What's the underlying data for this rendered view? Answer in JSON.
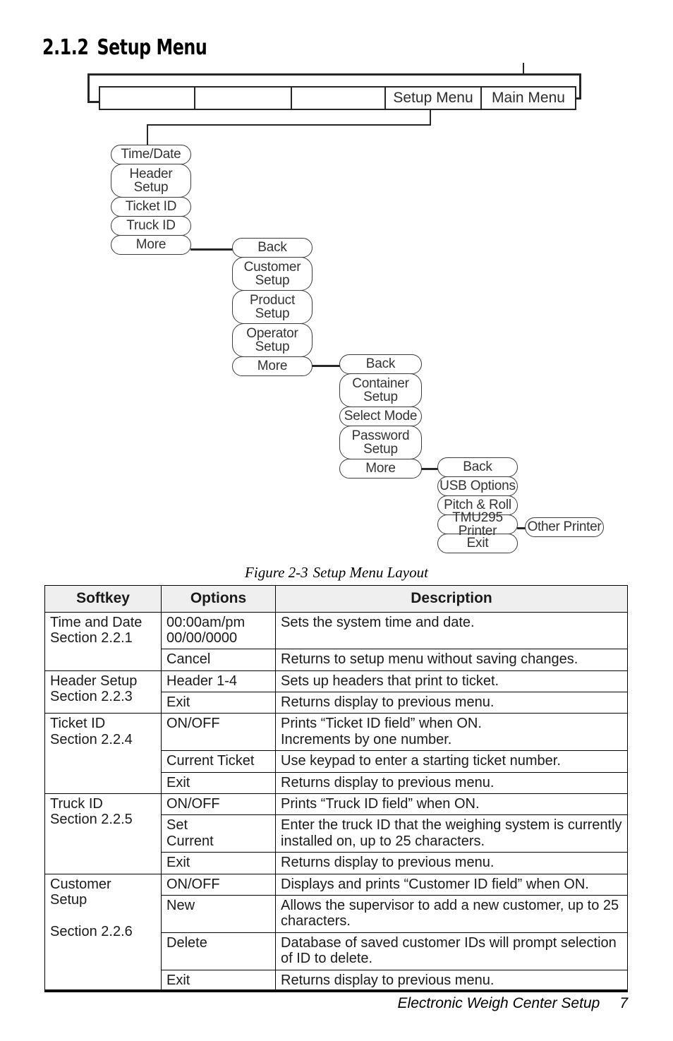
{
  "heading": {
    "number": "2.1.2",
    "title": "Setup Menu"
  },
  "diagram": {
    "menu_bar": [
      {
        "label": ""
      },
      {
        "label": ""
      },
      {
        "label": ""
      },
      {
        "label": "Setup Menu"
      },
      {
        "label": "Main Menu"
      }
    ],
    "columns": [
      {
        "name": "setup-level-1",
        "buttons": [
          "Time/Date",
          "Header\nSetup",
          "Ticket ID",
          "Truck ID",
          "More"
        ]
      },
      {
        "name": "setup-level-2",
        "buttons": [
          "Back",
          "Customer\nSetup",
          "Product\nSetup",
          "Operator\nSetup",
          "More"
        ]
      },
      {
        "name": "setup-level-3",
        "buttons": [
          "Back",
          "Container\nSetup",
          "Select Mode",
          "Password\nSetup",
          "More"
        ]
      },
      {
        "name": "setup-level-4",
        "buttons": [
          "Back",
          "USB Options",
          "Pitch & Roll",
          "TMU295 Printer",
          "Exit"
        ]
      }
    ],
    "branch_button": "Other Printer"
  },
  "caption": {
    "figure": "Figure 2-3",
    "title": "Setup Menu Layout"
  },
  "table": {
    "headers": [
      "Softkey",
      "Options",
      "Description"
    ],
    "rows": [
      {
        "softkey": "Time and Date\nSection 2.2.1",
        "softkey_rowspan": 2,
        "options": "00:00am/pm\n00/00/0000",
        "description": "Sets the system time and date."
      },
      {
        "options": "Cancel",
        "description": "Returns to setup menu without saving changes."
      },
      {
        "softkey": "Header Setup\nSection 2.2.3",
        "softkey_rowspan": 2,
        "options": "Header 1-4",
        "description": "Sets up headers that print to ticket."
      },
      {
        "options": "Exit",
        "description": "Returns display to previous menu."
      },
      {
        "softkey": "Ticket ID\nSection 2.2.4",
        "softkey_rowspan": 3,
        "options": "ON/OFF",
        "description": "Prints “Ticket ID field” when ON.\nIncrements by one number."
      },
      {
        "options": "Current Ticket",
        "description": "Use keypad to enter a starting ticket number."
      },
      {
        "options": "Exit",
        "description": "Returns display to previous menu."
      },
      {
        "softkey": "Truck ID\nSection 2.2.5",
        "softkey_rowspan": 3,
        "options": "ON/OFF",
        "description": "Prints “Truck ID field” when ON."
      },
      {
        "options": "Set\nCurrent",
        "description": "Enter the truck ID that the weighing system is currently installed on, up to 25 characters."
      },
      {
        "options": "Exit",
        "description": "Returns display to previous menu."
      },
      {
        "softkey": "Customer\nSetup\n\nSection 2.2.6",
        "softkey_rowspan": 4,
        "options": "ON/OFF",
        "description": "Displays and prints “Customer ID field” when ON."
      },
      {
        "options": "New",
        "description": "Allows the supervisor to add a new customer, up to 25 characters."
      },
      {
        "options": "Delete",
        "description": "Database of saved customer IDs will prompt selection of ID to delete."
      },
      {
        "options": "Exit",
        "description": "Returns display to previous menu."
      }
    ]
  },
  "footer": {
    "text": "Electronic Weigh Center Setup",
    "page": "7"
  }
}
